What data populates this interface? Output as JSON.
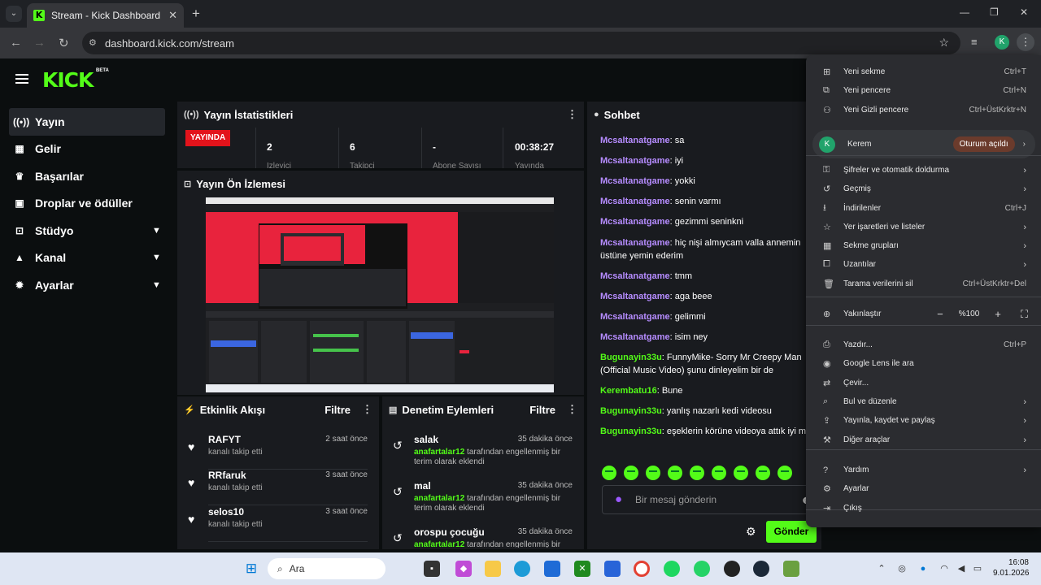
{
  "browser": {
    "tab_title": "Stream - Kick Dashboard",
    "url": "dashboard.kick.com/stream",
    "profile_initial": "K"
  },
  "kick": {
    "logo": "KICK",
    "beta": "BETA",
    "nav": [
      {
        "label": "Yayın",
        "icon": "broadcast-icon"
      },
      {
        "label": "Gelir",
        "icon": "chart-icon"
      },
      {
        "label": "Başarılar",
        "icon": "trophy-icon"
      },
      {
        "label": "Droplar ve ödüller",
        "icon": "gift-icon"
      },
      {
        "label": "Stüdyo",
        "icon": "studio-icon"
      },
      {
        "label": "Kanal",
        "icon": "user-icon"
      },
      {
        "label": "Ayarlar",
        "icon": "gear-icon"
      }
    ]
  },
  "stats": {
    "title": "Yayın İstatistikleri",
    "live_badge": "YAYINDA",
    "viewers": "2",
    "viewers_label": "İzleyici",
    "followers": "6",
    "followers_label": "Takipçi",
    "subs": "-",
    "subs_label": "Abone Sayısı",
    "duration": "00:38:27",
    "duration_label": "Yayında"
  },
  "preview": {
    "title": "Yayın Ön İzlemesi"
  },
  "activity": {
    "title": "Etkinlik Akışı",
    "filter": "Filtre",
    "items": [
      {
        "name": "RAFYT",
        "text": "kanalı takip etti",
        "time": "2 saat önce"
      },
      {
        "name": "RRfaruk",
        "text": "kanalı takip etti",
        "time": "3 saat önce"
      },
      {
        "name": "selos10",
        "text": "kanalı takip etti",
        "time": "3 saat önce"
      }
    ]
  },
  "moderation": {
    "title": "Denetim Eylemleri",
    "filter": "Filtre",
    "items": [
      {
        "term": "salak",
        "time": "35 dakika önce",
        "by": "anafartalar12",
        "text": " tarafından engellenmiş bir terim olarak eklendi"
      },
      {
        "term": "mal",
        "time": "35 dakika önce",
        "by": "anafartalar12",
        "text": " tarafından engellenmiş bir terim olarak eklendi"
      },
      {
        "term": "orospu çocuğu",
        "time": "35 dakika önce",
        "by": "anafartalar12",
        "text": " tarafından engellenmiş bir"
      }
    ]
  },
  "chat": {
    "title": "Sohbet",
    "placeholder": "Bir mesaj gönderin",
    "send": "Gönder",
    "messages": [
      {
        "user": "Mcsaltanatgame",
        "text": ": sa",
        "c": "u1"
      },
      {
        "user": "Mcsaltanatgame",
        "text": ": iyi",
        "c": "u1"
      },
      {
        "user": "Mcsaltanatgame",
        "text": ": yokki",
        "c": "u1"
      },
      {
        "user": "Mcsaltanatgame",
        "text": ": senin varmı",
        "c": "u1"
      },
      {
        "user": "Mcsaltanatgame",
        "text": ": gezimmi seninkni",
        "c": "u1"
      },
      {
        "user": "Mcsaltanatgame",
        "text": ": hiç nişi almıycam valla annemin üstüne yemin ederim",
        "c": "u1"
      },
      {
        "user": "Mcsaltanatgame",
        "text": ": tmm",
        "c": "u1"
      },
      {
        "user": "Mcsaltanatgame",
        "text": ": aga beee",
        "c": "u1"
      },
      {
        "user": "Mcsaltanatgame",
        "text": ": gelimmi",
        "c": "u1"
      },
      {
        "user": "Mcsaltanatgame",
        "text": ": isim ney",
        "c": "u1"
      },
      {
        "user": "Bugunayin33u",
        "text": ": FunnyMike- Sorry Mr Creepy Man (Official Music Video) şunu dinleyelim bir de",
        "c": "u2"
      },
      {
        "user": "Kerembatu16",
        "text": ": Bune",
        "c": "u2"
      },
      {
        "user": "Bugunayin33u",
        "text": ": yanlış nazarlı kedi videosu",
        "c": "u2"
      },
      {
        "user": "Bugunayin33u",
        "text": ": eşeklerin körüne videoya attık iyi mi :D",
        "c": "u2"
      }
    ]
  },
  "menu": {
    "items": [
      {
        "label": "Yeni sekme",
        "shortcut": "Ctrl+T",
        "icon": "new-tab-icon"
      },
      {
        "label": "Yeni pencere",
        "shortcut": "Ctrl+N",
        "icon": "new-window-icon"
      },
      {
        "label": "Yeni Gizli pencere",
        "shortcut": "Ctrl+ÜstKrktr+N",
        "icon": "incognito-icon"
      },
      {
        "label": "Şifreler ve otomatik doldurma",
        "shortcut": "",
        "icon": "key-icon",
        "arrow": true
      },
      {
        "label": "Geçmiş",
        "shortcut": "",
        "icon": "history-icon",
        "arrow": true
      },
      {
        "label": "İndirilenler",
        "shortcut": "Ctrl+J",
        "icon": "download-icon"
      },
      {
        "label": "Yer işaretleri ve listeler",
        "shortcut": "",
        "icon": "star-icon",
        "arrow": true
      },
      {
        "label": "Sekme grupları",
        "shortcut": "",
        "icon": "tab-groups-icon",
        "arrow": true
      },
      {
        "label": "Uzantılar",
        "shortcut": "",
        "icon": "extension-icon",
        "arrow": true
      },
      {
        "label": "Tarama verilerini sil",
        "shortcut": "Ctrl+ÜstKrktr+Del",
        "icon": "trash-icon"
      },
      {
        "label": "Yazdır...",
        "shortcut": "Ctrl+P",
        "icon": "print-icon"
      },
      {
        "label": "Google Lens ile ara",
        "shortcut": "",
        "icon": "lens-icon"
      },
      {
        "label": "Çevir...",
        "shortcut": "",
        "icon": "translate-icon"
      },
      {
        "label": "Bul ve düzenle",
        "shortcut": "",
        "icon": "find-icon",
        "arrow": true
      },
      {
        "label": "Yayınla, kaydet ve paylaş",
        "shortcut": "",
        "icon": "cast-icon",
        "arrow": true
      },
      {
        "label": "Diğer araçlar",
        "shortcut": "",
        "icon": "tools-icon",
        "arrow": true
      },
      {
        "label": "Yardım",
        "shortcut": "",
        "icon": "help-icon",
        "arrow": true
      },
      {
        "label": "Ayarlar",
        "shortcut": "",
        "icon": "settings-icon"
      },
      {
        "label": "Çıkış",
        "shortcut": "",
        "icon": "exit-icon"
      }
    ],
    "profile_name": "Kerem",
    "profile_status": "Oturum açıldı",
    "zoom_label": "Yakınlaştır",
    "zoom_value": "%100"
  },
  "taskbar": {
    "search": "Ara",
    "time": "16:08",
    "date": "9.01.2026"
  }
}
